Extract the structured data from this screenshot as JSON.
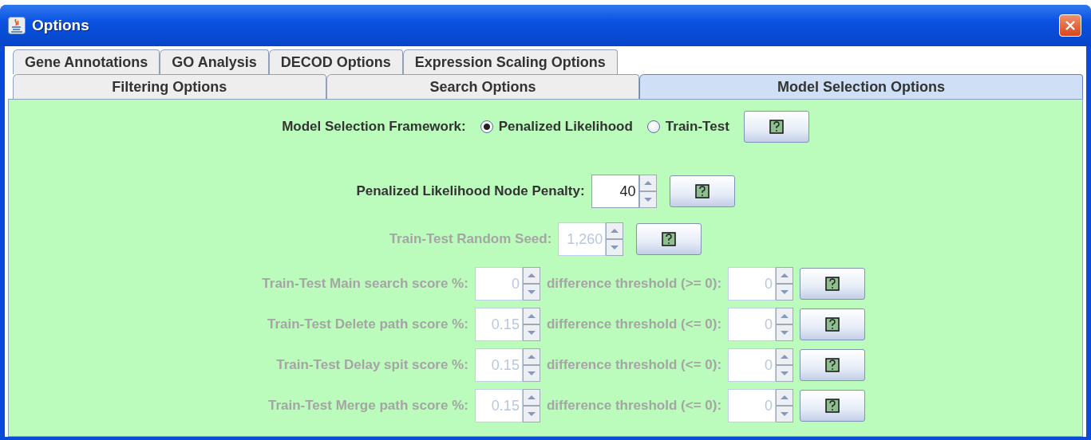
{
  "window": {
    "title": "Options"
  },
  "tab_rows": [
    {
      "tabs": [
        {
          "label": "Gene Annotations",
          "selected": false
        },
        {
          "label": "GO Analysis",
          "selected": false
        },
        {
          "label": "DECOD Options",
          "selected": false
        },
        {
          "label": "Expression Scaling Options",
          "selected": false
        }
      ]
    },
    {
      "tabs": [
        {
          "label": "Filtering Options",
          "selected": false
        },
        {
          "label": "Search Options",
          "selected": false
        },
        {
          "label": "Model Selection Options",
          "selected": true
        }
      ]
    }
  ],
  "framework": {
    "label": "Model Selection Framework:",
    "options": [
      {
        "label": "Penalized Likelihood",
        "selected": true
      },
      {
        "label": "Train-Test",
        "selected": false
      }
    ]
  },
  "node_penalty": {
    "label": "Penalized Likelihood Node Penalty:",
    "value": "40",
    "disabled": false
  },
  "random_seed": {
    "label": "Train-Test Random Seed:",
    "value": "1,260",
    "disabled": true
  },
  "score_rows": [
    {
      "label": "Train-Test Main search score %:",
      "value": "0",
      "threshold_label": "difference threshold (>= 0):",
      "threshold_value": "0",
      "disabled": true
    },
    {
      "label": "Train-Test Delete path score %:",
      "value": "0.15",
      "threshold_label": "difference threshold (<= 0):",
      "threshold_value": "0",
      "disabled": true
    },
    {
      "label": "Train-Test Delay spit score %:",
      "value": "0.15",
      "threshold_label": "difference threshold (<= 0):",
      "threshold_value": "0",
      "disabled": true
    },
    {
      "label": "Train-Test Merge path score %:",
      "value": "0.15",
      "threshold_label": "difference threshold (<= 0):",
      "threshold_value": "0",
      "disabled": true
    }
  ]
}
